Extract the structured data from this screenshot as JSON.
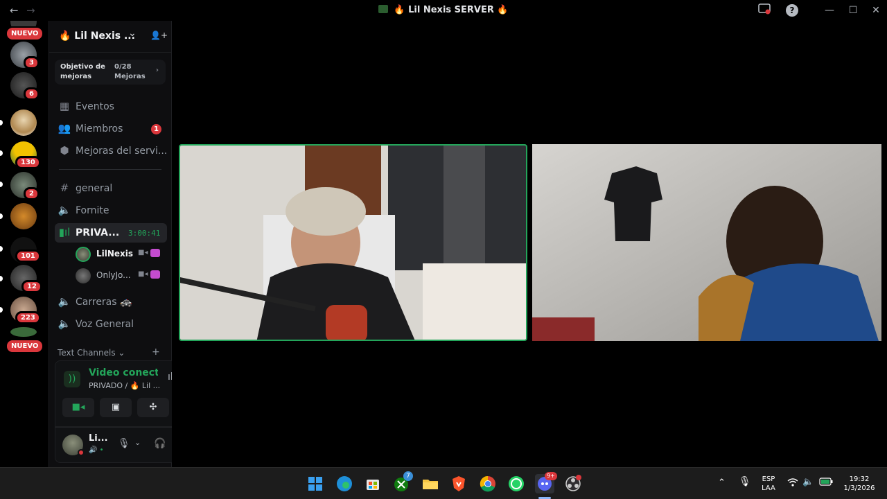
{
  "window": {
    "title": "🔥 Lil Nexis SERVER 🔥",
    "back_glyph": "←",
    "forward_glyph": "→",
    "help_glyph": "?",
    "minimize_glyph": "—",
    "maximize_glyph": "☐",
    "close_glyph": "✕"
  },
  "rail": {
    "nuevo_top": "NUEVO",
    "nuevo_bottom": "NUEVO",
    "badges": [
      "3",
      "6",
      "130",
      "2",
      "101",
      "12",
      "223"
    ]
  },
  "server": {
    "name": "🔥 Lil Nexis ...",
    "dropdown_glyph": "⌄",
    "invite_glyph": "👤+"
  },
  "boost": {
    "goal_label": "Objetivo de mejoras",
    "progress": "0/28 Mejoras",
    "chevron": "›"
  },
  "menu": {
    "events": "Eventos",
    "members": "Miembros",
    "members_badge": "1",
    "boosts": "Mejoras del servi..."
  },
  "channels": {
    "general": "general",
    "fornite": "Fornite",
    "privado": "PRIVA...",
    "privado_timer": "3:00:41",
    "carreras": "Carreras 🚓",
    "voz_general": "Voz General",
    "text_channels_header": "Text Channels ⌄",
    "add_glyph": "+"
  },
  "members_in_call": [
    {
      "name": "LilNexis"
    },
    {
      "name": "OnlyJo..."
    }
  ],
  "voice_panel": {
    "status": "Video conectado",
    "location": "PRIVADO / 🔥 Lil ..."
  },
  "user_panel": {
    "name": "Li...",
    "status_glyph": "🔊 •"
  },
  "taskbar": {
    "lang_top": "ESP",
    "lang_bottom": "LAA",
    "time": "19:32",
    "date": "1/3/2026",
    "discord_badge": "9+",
    "xbox_badge": "7"
  },
  "colors": {
    "accent_green": "#23a55a",
    "badge_red": "#da373c",
    "live_purple": "#c44ccf"
  }
}
